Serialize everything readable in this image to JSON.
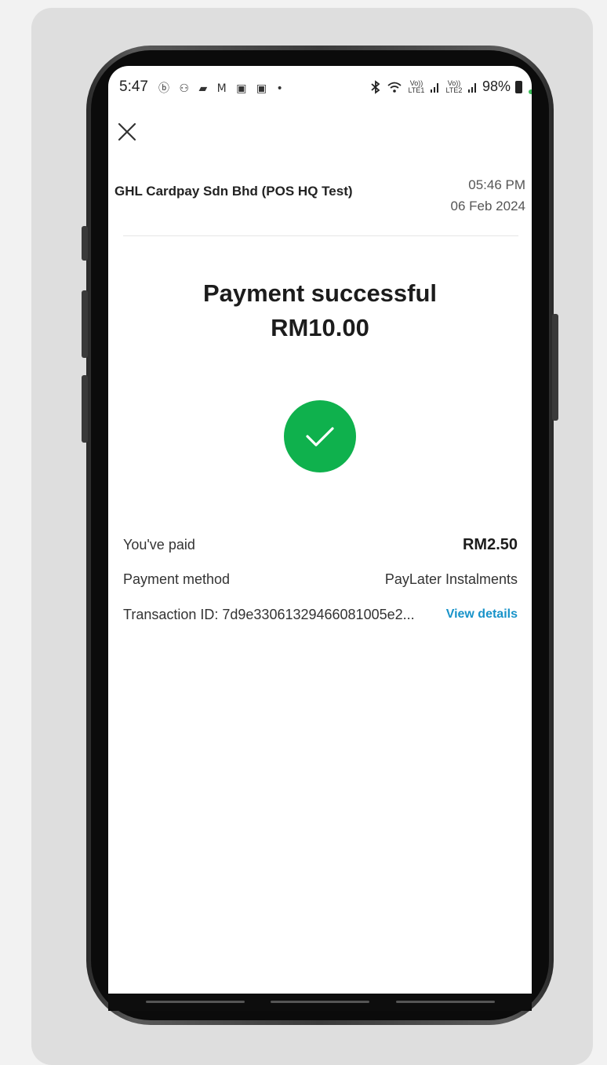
{
  "status_bar": {
    "time": "5:47",
    "left_icons": "ⓑ ⚇ ▰ M ▣ ▣ •",
    "battery": "98%",
    "sim1_label": "Vo)) LTE1",
    "sim2_label": "Vo)) LTE2"
  },
  "icons": {
    "close": "close-icon",
    "success": "checkmark-icon",
    "bluetooth": "bluetooth-icon",
    "wifi": "wifi-icon",
    "battery": "battery-icon"
  },
  "header": {
    "merchant": "GHL Cardpay Sdn Bhd (POS HQ Test)",
    "time": "05:46 PM",
    "date": "06 Feb 2024"
  },
  "result": {
    "title": "Payment successful",
    "amount": "RM10.00"
  },
  "details": {
    "paid_label": "You've paid",
    "paid_value": "RM2.50",
    "method_label": "Payment method",
    "method_value": "PayLater Instalments",
    "txn_label": "Transaction ID: 7d9e33061329466081005e2...",
    "view_details": "View details"
  },
  "colors": {
    "success_green": "#0fb14d",
    "link_blue": "#1893c9"
  }
}
